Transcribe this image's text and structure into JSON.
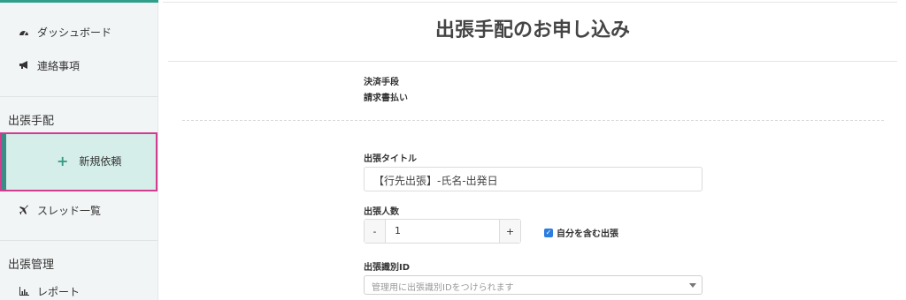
{
  "sidebar": {
    "items": [
      {
        "label": "ダッシュボード",
        "icon": "dashboard-icon"
      },
      {
        "label": "連絡事項",
        "icon": "megaphone-icon"
      }
    ],
    "section1": {
      "title": "出張手配",
      "new_request": {
        "label": "新規依頼",
        "icon": "plus-icon"
      },
      "thread_list": {
        "label": "スレッド一覧",
        "icon": "airplane-icon"
      }
    },
    "section2": {
      "title": "出張管理",
      "report": {
        "label": "レポート",
        "icon": "bar-chart-icon"
      }
    }
  },
  "main": {
    "title": "出張手配のお申し込み",
    "payment": {
      "label": "決済手段",
      "value": "請求書払い"
    },
    "trip_title": {
      "label": "出張タイトル",
      "value": "【行先出張】-氏名-出発日"
    },
    "trip_count": {
      "label": "出張人数",
      "minus": "-",
      "value": "1",
      "plus": "+"
    },
    "include_self": {
      "label": "自分を含む出張",
      "checked": true
    },
    "trip_id": {
      "label": "出張識別ID",
      "placeholder": "管理用に出張識別IDをつけられます"
    }
  },
  "colors": {
    "accent": "#2f9f8c",
    "highlight_border": "#d23c8e",
    "checkbox": "#2b7de0"
  }
}
